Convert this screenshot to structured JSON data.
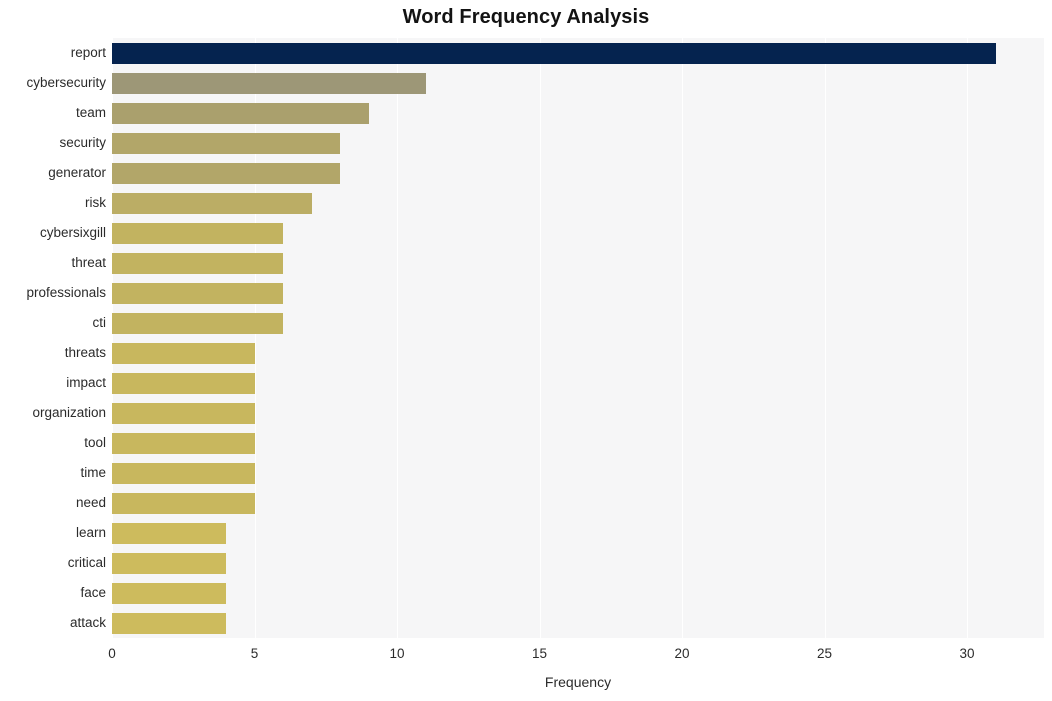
{
  "chart_data": {
    "type": "bar",
    "orientation": "horizontal",
    "title": "Word Frequency Analysis",
    "xlabel": "Frequency",
    "ylabel": "",
    "categories": [
      "report",
      "cybersecurity",
      "team",
      "security",
      "generator",
      "risk",
      "cybersixgill",
      "threat",
      "professionals",
      "cti",
      "threats",
      "impact",
      "organization",
      "tool",
      "time",
      "need",
      "learn",
      "critical",
      "face",
      "attack"
    ],
    "values": [
      31,
      11,
      9,
      8,
      8,
      7,
      6,
      6,
      6,
      6,
      5,
      5,
      5,
      5,
      5,
      5,
      4,
      4,
      4,
      4
    ],
    "bar_colors": [
      "#05234f",
      "#9d9777",
      "#aaa06d",
      "#b2a669",
      "#b2a669",
      "#bbad65",
      "#c2b360",
      "#c2b360",
      "#c2b360",
      "#c2b360",
      "#c8b75e",
      "#c8b75e",
      "#c8b75e",
      "#c8b75e",
      "#c8b75e",
      "#c8b75e",
      "#cdbb5d",
      "#cdbb5d",
      "#cdbb5d",
      "#cdbb5d"
    ],
    "xlim": [
      0,
      32.7
    ],
    "xticks": [
      0,
      5,
      10,
      15,
      20,
      25,
      30
    ],
    "xtick_labels": [
      "0",
      "5",
      "10",
      "15",
      "20",
      "25",
      "30"
    ],
    "grid": true,
    "grid_color": "#ffffff",
    "plot_background": "#f6f6f7",
    "figure_background": "#ffffff",
    "legend": null
  }
}
